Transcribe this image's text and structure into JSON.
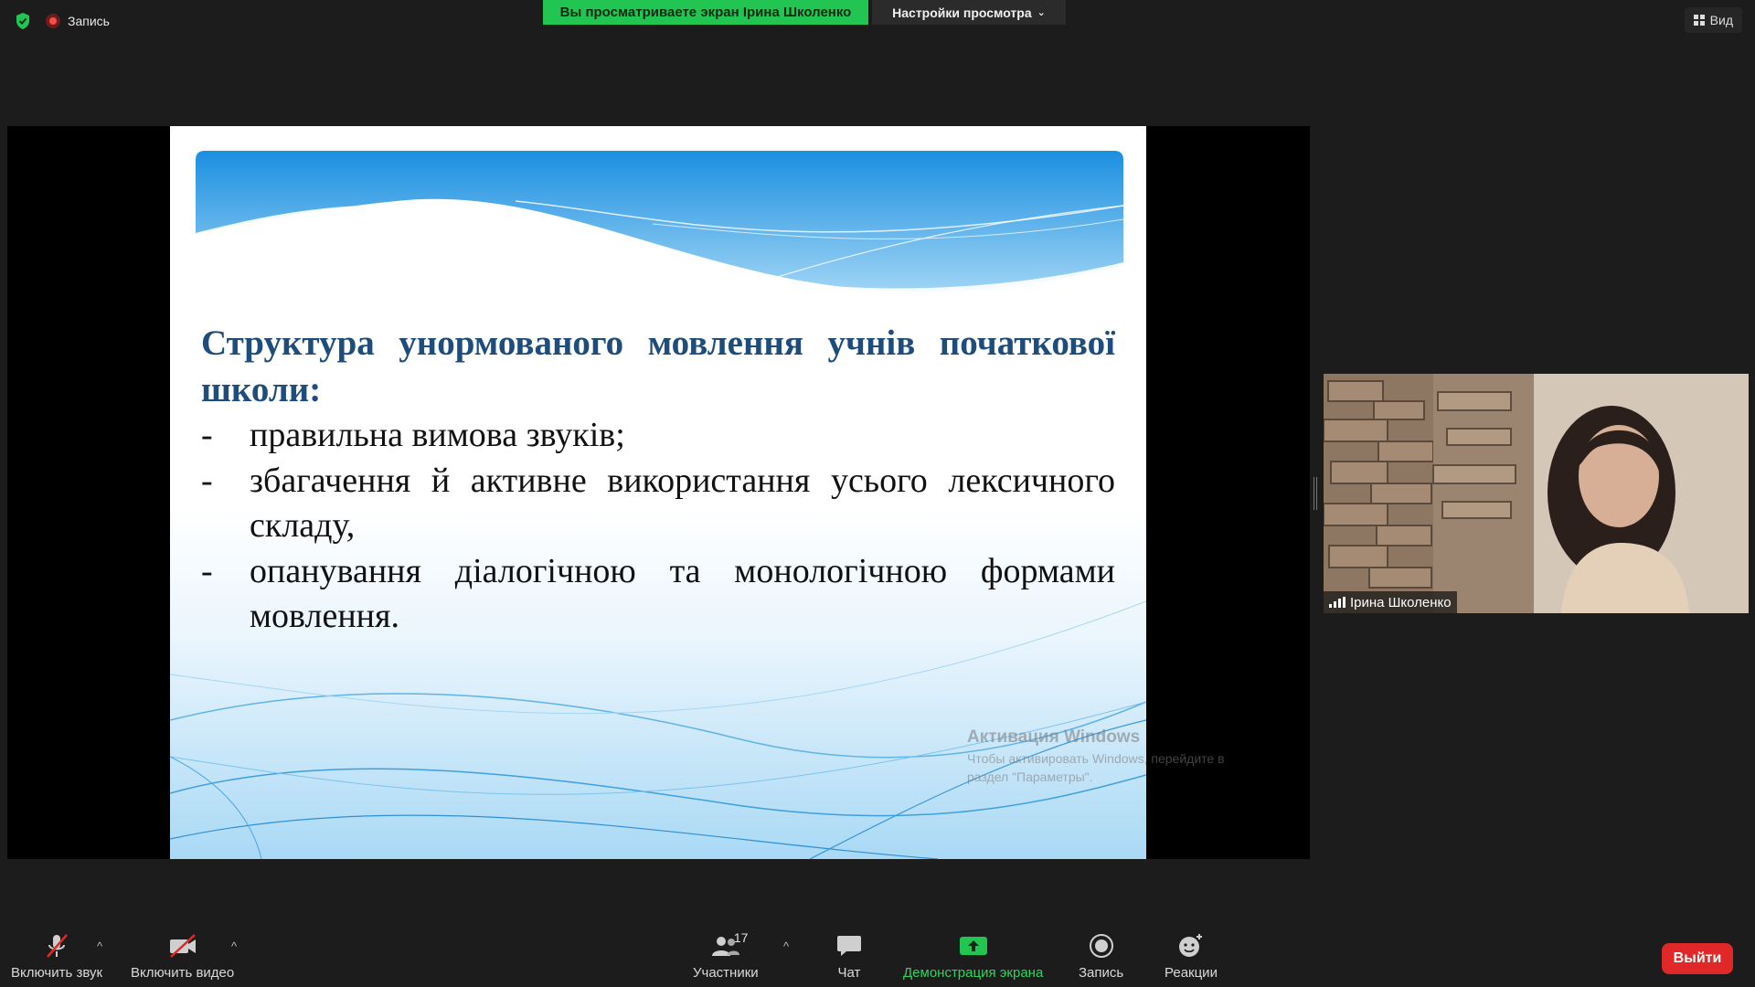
{
  "top_bar": {
    "security_icon": "shield-check-icon",
    "recording_label": "Запись",
    "viewing_banner": "Вы просматриваете экран Ірина Школенко",
    "view_settings_label": "Настройки просмотра",
    "view_label": "Вид"
  },
  "slide": {
    "title": "Структура унормованого мовлення учнів початкової школи:",
    "bullets": [
      {
        "dash": "-",
        "text": "правильна вимова звуків;"
      },
      {
        "dash": "-",
        "text": "збагачення й активне використання усього лексичного складу,"
      },
      {
        "dash": "-",
        "text": "опанування діалогічною та монологічною формами мовлення."
      }
    ]
  },
  "watermark": {
    "title": "Активация Windows",
    "text": "Чтобы активировать Windows, перейдите в раздел \"Параметры\"."
  },
  "participant": {
    "name": "Ірина Школенко"
  },
  "toolbar": {
    "audio_label": "Включить звук",
    "video_label": "Включить видео",
    "participants_label": "Участники",
    "participants_count": "17",
    "chat_label": "Чат",
    "share_label": "Демонстрация экрана",
    "record_label": "Запись",
    "reactions_label": "Реакции",
    "leave_label": "Выйти",
    "caret": "^"
  },
  "colors": {
    "share_green": "#23c552",
    "leave_red": "#e02828",
    "title_blue": "#1e4d7b"
  }
}
